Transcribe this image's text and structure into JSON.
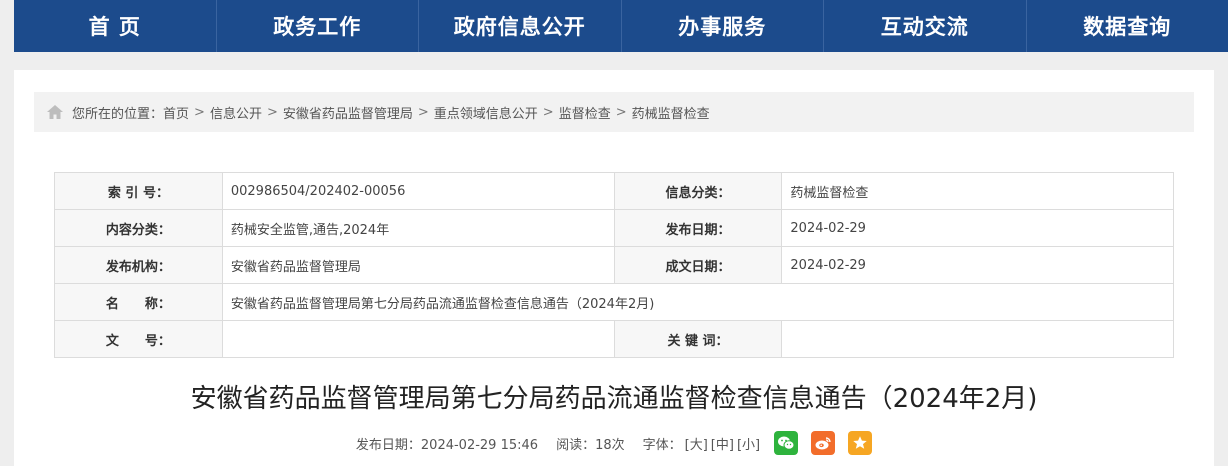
{
  "nav": {
    "items": [
      {
        "label": "首 页"
      },
      {
        "label": "政务工作"
      },
      {
        "label": "政府信息公开"
      },
      {
        "label": "办事服务"
      },
      {
        "label": "互动交流"
      },
      {
        "label": "数据查询"
      }
    ]
  },
  "breadcrumb": {
    "prefix": "您所在的位置：",
    "items": [
      "首页",
      "信息公开",
      "安徽省药品监督管理局",
      "重点领域信息公开",
      "监督检查",
      "药械监督检查"
    ],
    "separator": ">"
  },
  "meta": {
    "index_label": "索 引 号：",
    "index_value": "002986504/202402-00056",
    "category_label": "信息分类：",
    "category_value": "药械监督检查",
    "content_label": "内容分类：",
    "content_value": "药械安全监管,通告,2024年",
    "publish_date_label": "发布日期：",
    "publish_date_value": "2024-02-29",
    "org_label": "发布机构：",
    "org_value": "安徽省药品监督管理局",
    "doc_date_label": "成文日期：",
    "doc_date_value": "2024-02-29",
    "name_label": "名　　称：",
    "name_value": "安徽省药品监督管理局第七分局药品流通监督检查信息通告（2024年2月)",
    "docno_label": "文　　号：",
    "docno_value": "",
    "keywords_label": "关 键 词：",
    "keywords_value": ""
  },
  "article": {
    "title": "安徽省药品监督管理局第七分局药品流通监督检查信息通告（2024年2月)",
    "publish_label": "发布日期：2024-02-29 15:46",
    "reads_label": "阅读：18次",
    "font_label": "字体：",
    "font_large": "[大]",
    "font_medium": "[中]",
    "font_small": "[小]"
  },
  "colors": {
    "nav_bg": "#1c4b8c",
    "wechat": "#2eb33d",
    "weibo": "#f26d2b",
    "favorite": "#f6a623"
  },
  "icons": [
    "home-icon",
    "wechat-icon",
    "weibo-icon",
    "star-icon"
  ]
}
